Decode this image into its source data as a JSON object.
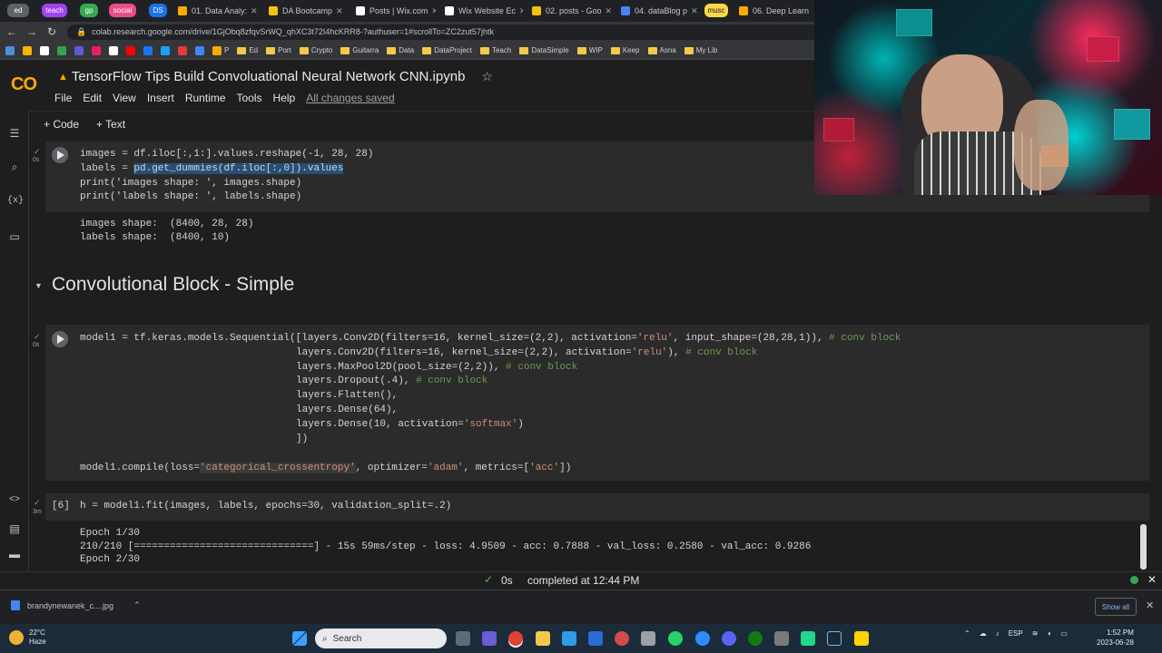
{
  "browser": {
    "tab_groups": [
      "ed",
      "teach",
      "gp",
      "social",
      "DS",
      "musc"
    ],
    "tabs": [
      "01. Data Analy:",
      "DA Bootcamp",
      "Posts | Wix.com",
      "Wix Website Ec",
      "02. posts - Goo",
      "04. dataBlog p",
      "06. Deep Learn"
    ],
    "url": "colab.research.google.com/drive/1GjObq8zfqvSrWQ_qhXC3t72I4hcKRR8-?authuser=1#scrollTo=ZC2zut57jhtk",
    "bookmarks": [
      "Ed",
      "Port",
      "Crypto",
      "Guitarra",
      "Data",
      "DataProject",
      "Teach",
      "DataSimple",
      "WIP",
      "Keep",
      "Asna",
      "My Lib"
    ],
    "bookmark_p": "P"
  },
  "colab": {
    "logo": "CO",
    "notebook_title": "TensorFlow Tips Build Convoluational Neural Network CNN.ipynb",
    "menu": [
      "File",
      "Edit",
      "View",
      "Insert",
      "Runtime",
      "Tools",
      "Help"
    ],
    "saved_status": "All changes saved",
    "add_code": "+ Code",
    "add_text": "+ Text"
  },
  "cells": {
    "cell1": {
      "time": "0s",
      "lines": {
        "l1": "images = df.iloc[:,1:].values.reshape(-1, 28, 28)",
        "l2a": "labels = ",
        "l2b": "pd.get_dummies(df.iloc[:,0]).values",
        "l3": "print('images shape: ', images.shape)",
        "l4": "print('labels shape: ', labels.shape)"
      },
      "output": [
        "images shape:  (8400, 28, 28)",
        "labels shape:  (8400, 10)"
      ]
    },
    "section_title": "Convolutional Block - Simple",
    "cell2": {
      "time": "0s",
      "lines": {
        "l1a": "model1 = tf.keras.models.Sequential([layers.Conv2D(filters=16, kernel_size=(2,2), activation=",
        "l1s": "'relu'",
        "l1b": ", input_shape=(28,28,1)), ",
        "l1c": "# conv block",
        "l2a": "layers.Conv2D(filters=16, kernel_size=(2,2), activation=",
        "l2s": "'relu'",
        "l2b": "), ",
        "l2c": "# conv block",
        "l3a": "layers.MaxPool2D(pool_size=(2,2)), ",
        "l3c": "# conv block",
        "l4a": "layers.Dropout(.4), ",
        "l4c": "# conv block",
        "l5": "layers.Flatten(),",
        "l6": "layers.Dense(64),",
        "l7a": "layers.Dense(10, activation=",
        "l7s": "'softmax'",
        "l7b": ")",
        "l8": "])",
        "c1a": "model1.compile(loss=",
        "c1s": "'categorical_crossentropy'",
        "c1b": ", optimizer=",
        "c1s2": "'adam'",
        "c1c": ", metrics=[",
        "c1s3": "'acc'",
        "c1d": "])"
      }
    },
    "cell3": {
      "time": "3m",
      "exec_count": "[6]",
      "code": "h = model1.fit(images, labels, epochs=30, validation_split=.2)",
      "output": [
        "Epoch 1/30",
        "210/210 [==============================] - 15s 59ms/step - loss: 4.9509 - acc: 0.7888 - val_loss: 0.2580 - val_acc: 0.9286",
        "Epoch 2/30"
      ]
    }
  },
  "statusbar": {
    "check": "✓",
    "duration": "0s",
    "message": "completed at 12:44 PM"
  },
  "downloads": {
    "file": "brandynewanek_c....jpg",
    "show_all": "Show all"
  },
  "taskbar": {
    "temp": "22°C",
    "weather": "Haze",
    "search": "Search",
    "lang": "ESP",
    "time": "1:52 PM",
    "date": "2023-06-28"
  }
}
